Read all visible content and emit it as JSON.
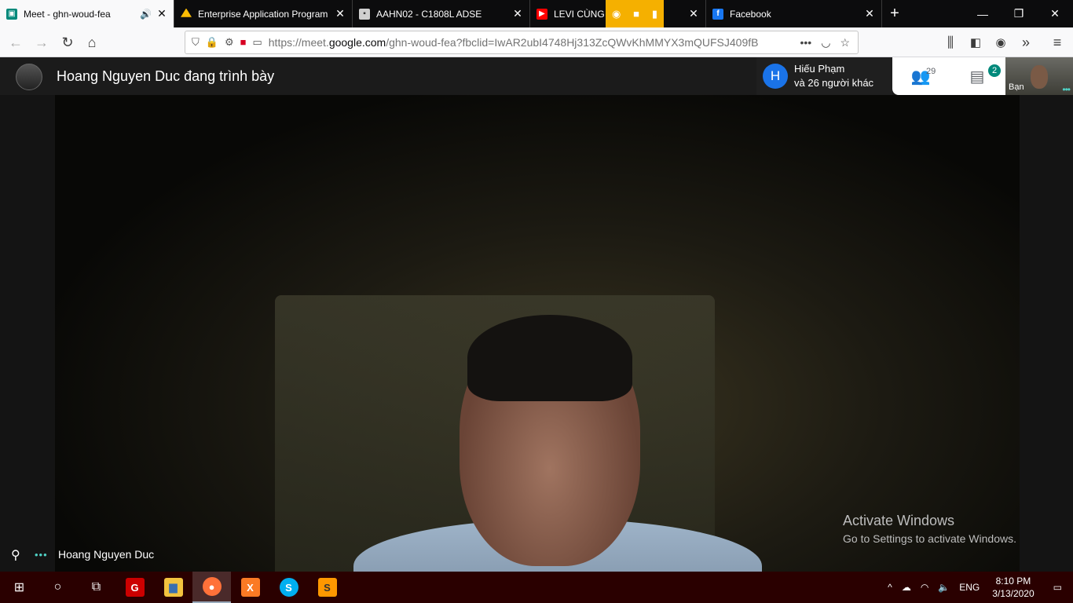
{
  "tabs": [
    {
      "title": "Meet - ghn-woud-fea",
      "icon": "meet-icon",
      "color": "#00897b",
      "audio": "🔊",
      "active": true
    },
    {
      "title": "Enterprise Application Program",
      "icon": "drive-icon",
      "color": "#fbbc04",
      "active": false
    },
    {
      "title": "AAHN02 - C1808L ADSE",
      "icon": "classroom-icon",
      "color": "#cfcfcf",
      "active": false
    },
    {
      "title": "LEVI CÙNG D... NHA",
      "icon": "youtube-icon",
      "color": "#ff0000",
      "active": false
    },
    {
      "title": "Facebook",
      "icon": "facebook-icon",
      "color": "#1877f2",
      "active": false
    }
  ],
  "new_tab_label": "+",
  "window_controls": {
    "minimize": "—",
    "restore": "❐",
    "close": "✕"
  },
  "url": {
    "prefix": "https://meet.",
    "domain": "google.com",
    "rest": "/ghn-woud-fea?fbclid=IwAR2ubI4748Hj313ZcQWvKhMMYX3mQUFSJ409fB"
  },
  "meet": {
    "presenting_title": "Hoang Nguyen Duc đang trình bày",
    "participant_initial": "H",
    "participant_name": "Hiếu Phạm",
    "participant_others": "và 26 người khác",
    "people_count": "29",
    "chat_badge": "2",
    "self_label": "Bạn",
    "speaker_name": "Hoang Nguyen Duc"
  },
  "activate": {
    "title": "Activate Windows",
    "subtitle": "Go to Settings to activate Windows."
  },
  "taskbar": {
    "apps": [
      {
        "name": "garena-icon",
        "color": "#cc0000",
        "glyph": "G"
      },
      {
        "name": "file-explorer-icon",
        "color": "#f3c33f",
        "glyph": "▆"
      },
      {
        "name": "firefox-icon",
        "color": "#ff7139",
        "glyph": "●",
        "active": true
      },
      {
        "name": "xampp-icon",
        "color": "#fb7a24",
        "glyph": "X"
      },
      {
        "name": "skype-icon",
        "color": "#00aff0",
        "glyph": "S"
      },
      {
        "name": "sublime-icon",
        "color": "#ff9800",
        "glyph": "S"
      }
    ],
    "lang": "ENG",
    "time": "8:10 PM",
    "date": "3/13/2020"
  }
}
